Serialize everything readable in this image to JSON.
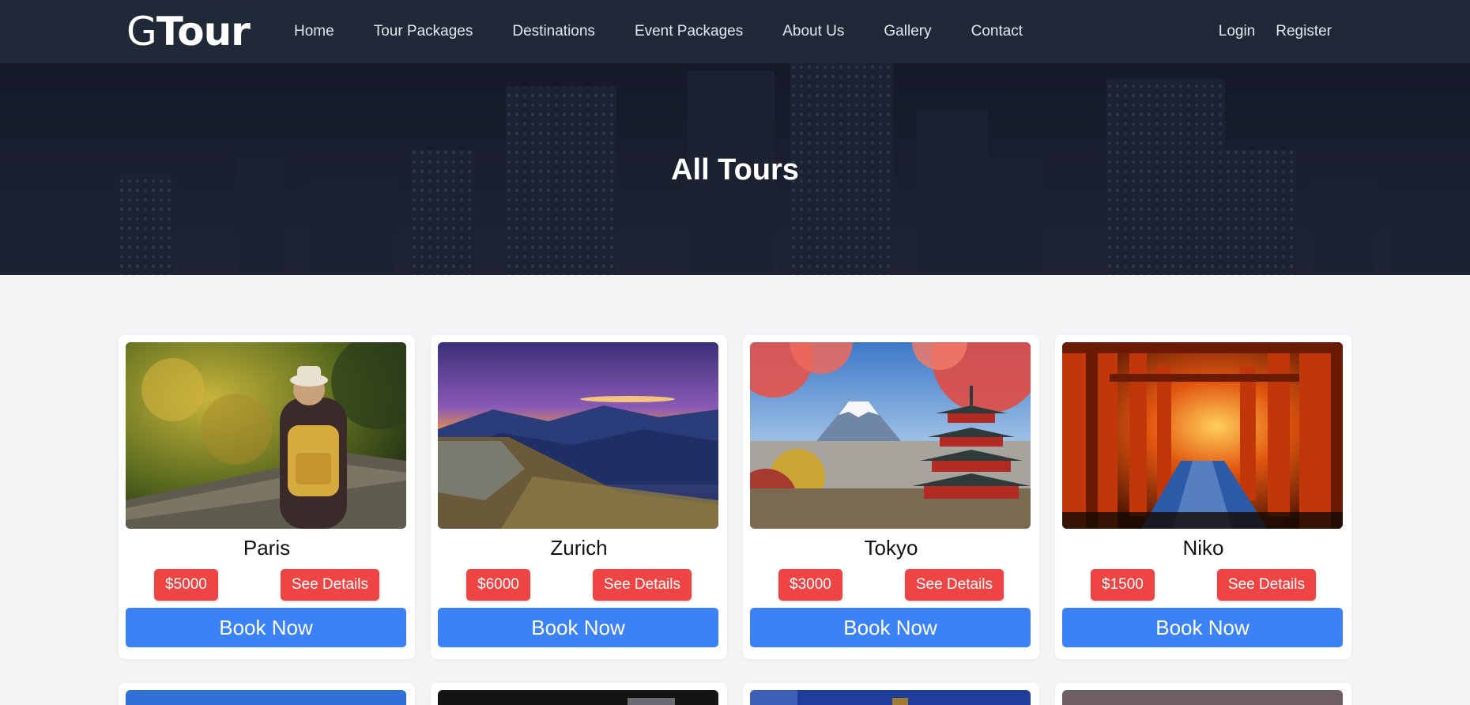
{
  "nav": {
    "logo_g": "G",
    "logo_rest": "Tour",
    "links": [
      "Home",
      "Tour Packages",
      "Destinations",
      "Event Packages",
      "About Us",
      "Gallery",
      "Contact"
    ],
    "login": "Login",
    "register": "Register"
  },
  "hero": {
    "title": "All Tours"
  },
  "tours": [
    {
      "city": "Paris",
      "price": "$5000",
      "details": "See Details",
      "book": "Book Now"
    },
    {
      "city": "Zurich",
      "price": "$6000",
      "details": "See Details",
      "book": "Book Now"
    },
    {
      "city": "Tokyo",
      "price": "$3000",
      "details": "See Details",
      "book": "Book Now"
    },
    {
      "city": "Niko",
      "price": "$1500",
      "details": "See Details",
      "book": "Book Now"
    }
  ],
  "colors": {
    "nav_bg": "#1f2937",
    "price_chip": "#ef4444",
    "book_button": "#3b82f6",
    "page_bg": "#f3f4f6"
  }
}
